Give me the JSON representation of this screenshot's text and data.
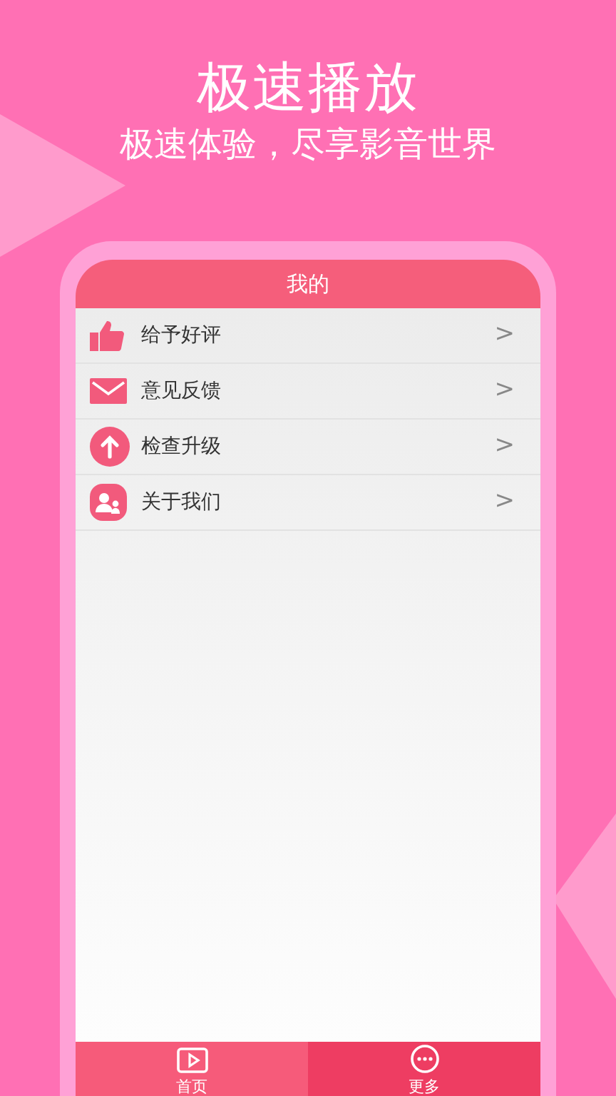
{
  "headline": "极速播放",
  "subheadline": "极速体验，尽享影音世界",
  "screen": {
    "title": "我的",
    "items": [
      {
        "kind": "thumb",
        "label": "给予好评",
        "chevron": ">"
      },
      {
        "kind": "mail",
        "label": "意见反馈",
        "chevron": ">"
      },
      {
        "kind": "upgrade",
        "label": "检查升级",
        "chevron": ">"
      },
      {
        "kind": "people",
        "label": "关于我们",
        "chevron": ">"
      }
    ],
    "tabs": [
      {
        "kind": "play",
        "label": "首页",
        "selected": false
      },
      {
        "kind": "more",
        "label": "更多",
        "selected": true
      }
    ]
  }
}
